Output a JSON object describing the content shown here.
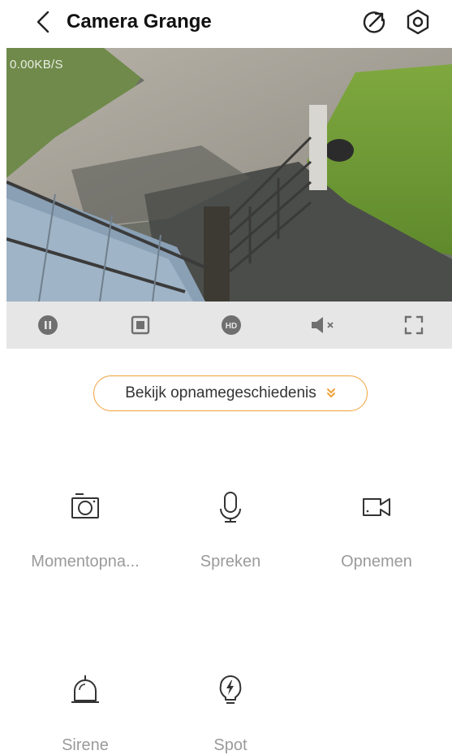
{
  "header": {
    "title": "Camera Grange",
    "back_icon": "chevron-left-icon",
    "share_icon": "share-arrow-icon",
    "settings_icon": "settings-hexagon-icon"
  },
  "video": {
    "bitrate": "0.00KB/S"
  },
  "controls": [
    {
      "name": "pause",
      "icon": "pause-icon"
    },
    {
      "name": "stop",
      "icon": "stop-icon"
    },
    {
      "name": "hd",
      "icon": "hd-icon",
      "label": "HD"
    },
    {
      "name": "mute",
      "icon": "speaker-muted-icon"
    },
    {
      "name": "fullscreen",
      "icon": "fullscreen-icon"
    }
  ],
  "history": {
    "label": "Bekijk opnamegeschiedenis",
    "icon": "double-chevron-down-icon"
  },
  "features": [
    {
      "label": "Momentopna...",
      "icon": "camera-icon"
    },
    {
      "label": "Spreken",
      "icon": "microphone-icon"
    },
    {
      "label": "Opnemen",
      "icon": "video-record-icon"
    },
    {
      "label": "Sirene",
      "icon": "siren-bell-icon"
    },
    {
      "label": "Spot",
      "icon": "lightbulb-icon"
    }
  ],
  "colors": {
    "accent": "#f0a13a",
    "label_gray": "#9a9a9a",
    "control_bar": "#e6e6e6",
    "control_icon": "#6f6f6f"
  }
}
